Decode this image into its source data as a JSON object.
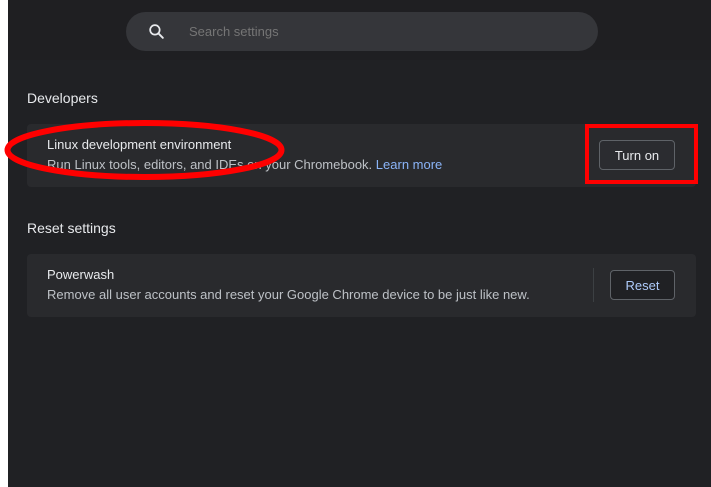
{
  "search": {
    "placeholder": "Search settings",
    "icon": "search-icon"
  },
  "developers": {
    "section_title": "Developers",
    "linux": {
      "title": "Linux development environment",
      "description": "Run Linux tools, editors, and IDEs on your Chromebook.",
      "learn_more": "Learn more",
      "button_label": "Turn on"
    }
  },
  "reset": {
    "section_title": "Reset settings",
    "powerwash": {
      "title": "Powerwash",
      "description": "Remove all user accounts and reset your Google Chrome device to be just like new.",
      "button_label": "Reset"
    }
  },
  "colors": {
    "background": "#202124",
    "card": "#292a2d",
    "link": "#8ab4f8",
    "annotation": "#ff0000"
  }
}
